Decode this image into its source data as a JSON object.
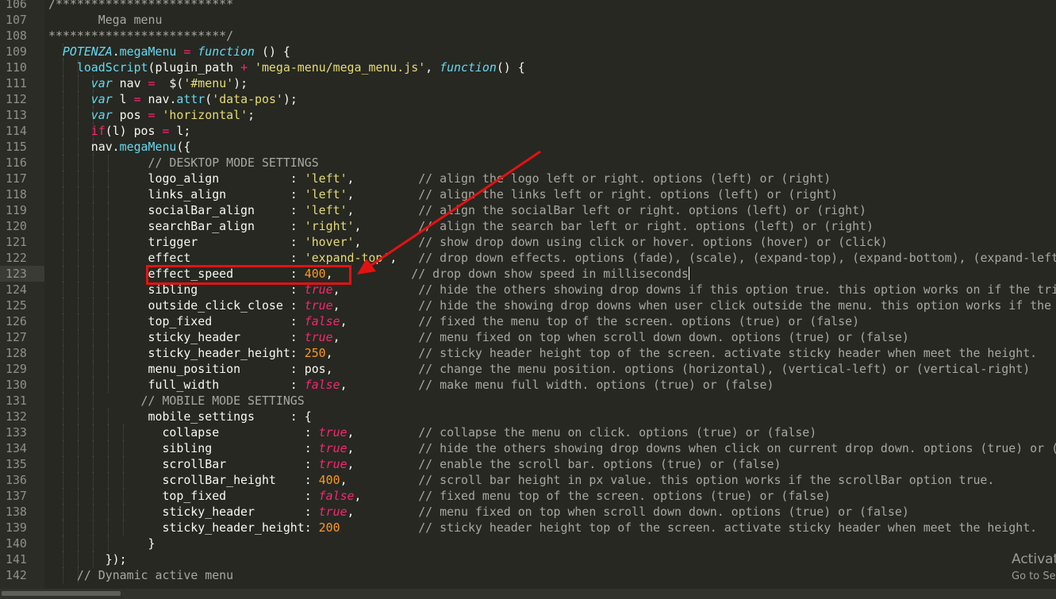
{
  "editor": {
    "current_line": 123,
    "lines": [
      {
        "n": "106",
        "indent": 0,
        "tokens": [
          {
            "t": "/*************************",
            "c": "com"
          }
        ]
      },
      {
        "n": "107",
        "indent": 0,
        "tokens": [
          {
            "t": "       Mega menu",
            "c": "com"
          }
        ]
      },
      {
        "n": "108",
        "indent": 0,
        "tokens": [
          {
            "t": "*************************/",
            "c": "com"
          }
        ]
      },
      {
        "n": "109",
        "indent": 1,
        "tokens": [
          {
            "t": "  POTENZA",
            "c": "gl"
          },
          {
            "t": ".",
            "c": "id"
          },
          {
            "t": "megaMenu",
            "c": "fn"
          },
          {
            "t": " = ",
            "c": "op"
          },
          {
            "t": "function",
            "c": "kw"
          },
          {
            "t": " () {",
            "c": "id"
          }
        ]
      },
      {
        "n": "110",
        "indent": 2,
        "tokens": [
          {
            "t": "    loadScript",
            "c": "fn"
          },
          {
            "t": "(plugin_path ",
            "c": "id"
          },
          {
            "t": "+",
            "c": "op"
          },
          {
            "t": " ",
            "c": "id"
          },
          {
            "t": "'mega-menu/mega_menu.js'",
            "c": "str"
          },
          {
            "t": ", ",
            "c": "id"
          },
          {
            "t": "function",
            "c": "kw"
          },
          {
            "t": "() {",
            "c": "id"
          }
        ]
      },
      {
        "n": "111",
        "indent": 3,
        "tokens": [
          {
            "t": "      ",
            "c": "id"
          },
          {
            "t": "var",
            "c": "kw"
          },
          {
            "t": " nav ",
            "c": "id"
          },
          {
            "t": "=",
            "c": "op"
          },
          {
            "t": "  $(",
            "c": "id"
          },
          {
            "t": "'#menu'",
            "c": "str"
          },
          {
            "t": ");",
            "c": "id"
          }
        ]
      },
      {
        "n": "112",
        "indent": 3,
        "tokens": [
          {
            "t": "      ",
            "c": "id"
          },
          {
            "t": "var",
            "c": "kw"
          },
          {
            "t": " l ",
            "c": "id"
          },
          {
            "t": "=",
            "c": "op"
          },
          {
            "t": " nav.",
            "c": "id"
          },
          {
            "t": "attr",
            "c": "fn"
          },
          {
            "t": "(",
            "c": "id"
          },
          {
            "t": "'data-pos'",
            "c": "str"
          },
          {
            "t": ");",
            "c": "id"
          }
        ]
      },
      {
        "n": "113",
        "indent": 3,
        "tokens": [
          {
            "t": "      ",
            "c": "id"
          },
          {
            "t": "var",
            "c": "kw"
          },
          {
            "t": " pos ",
            "c": "id"
          },
          {
            "t": "=",
            "c": "op"
          },
          {
            "t": " ",
            "c": "id"
          },
          {
            "t": "'horizontal'",
            "c": "str"
          },
          {
            "t": ";",
            "c": "id"
          }
        ]
      },
      {
        "n": "114",
        "indent": 3,
        "tokens": [
          {
            "t": "      ",
            "c": "id"
          },
          {
            "t": "if",
            "c": "op"
          },
          {
            "t": "(l) pos ",
            "c": "id"
          },
          {
            "t": "=",
            "c": "op"
          },
          {
            "t": " l;",
            "c": "id"
          }
        ]
      },
      {
        "n": "115",
        "indent": 3,
        "tokens": [
          {
            "t": "      nav.",
            "c": "id"
          },
          {
            "t": "megaMenu",
            "c": "fn"
          },
          {
            "t": "({",
            "c": "id"
          }
        ]
      },
      {
        "n": "116",
        "indent": 4,
        "tokens": [
          {
            "t": "              // DESKTOP MODE SETTINGS",
            "c": "com"
          }
        ]
      },
      {
        "n": "117",
        "indent": 4,
        "tokens": [
          {
            "t": "              logo_align          : ",
            "c": "id"
          },
          {
            "t": "'left'",
            "c": "str"
          },
          {
            "t": ",         ",
            "c": "id"
          },
          {
            "t": "// align the logo left or right. options (left) or (right)",
            "c": "com"
          }
        ]
      },
      {
        "n": "118",
        "indent": 4,
        "tokens": [
          {
            "t": "              links_align         : ",
            "c": "id"
          },
          {
            "t": "'left'",
            "c": "str"
          },
          {
            "t": ",         ",
            "c": "id"
          },
          {
            "t": "// align the links left or right. options (left) or (right)",
            "c": "com"
          }
        ]
      },
      {
        "n": "119",
        "indent": 4,
        "tokens": [
          {
            "t": "              socialBar_align     : ",
            "c": "id"
          },
          {
            "t": "'left'",
            "c": "str"
          },
          {
            "t": ",         ",
            "c": "id"
          },
          {
            "t": "// align the socialBar left or right. options (left) or (right)",
            "c": "com"
          }
        ]
      },
      {
        "n": "120",
        "indent": 4,
        "tokens": [
          {
            "t": "              searchBar_align     : ",
            "c": "id"
          },
          {
            "t": "'right'",
            "c": "str"
          },
          {
            "t": ",        ",
            "c": "id"
          },
          {
            "t": "// align the search bar left or right. options (left) or (right)",
            "c": "com"
          }
        ]
      },
      {
        "n": "121",
        "indent": 4,
        "tokens": [
          {
            "t": "              trigger             : ",
            "c": "id"
          },
          {
            "t": "'hover'",
            "c": "str"
          },
          {
            "t": ",        ",
            "c": "id"
          },
          {
            "t": "// show drop down using click or hover. options (hover) or (click)",
            "c": "com"
          }
        ]
      },
      {
        "n": "122",
        "indent": 4,
        "tokens": [
          {
            "t": "              effect              : ",
            "c": "id"
          },
          {
            "t": "'expand-top'",
            "c": "str"
          },
          {
            "t": ",   ",
            "c": "id"
          },
          {
            "t": "// drop down effects. options (fade), (scale), (expand-top), (expand-bottom), (expand-left), (expand-right)",
            "c": "com"
          }
        ]
      },
      {
        "n": "123",
        "indent": 4,
        "caret": true,
        "tokens": [
          {
            "t": "              effect_speed        : ",
            "c": "id"
          },
          {
            "t": "400",
            "c": "num2"
          },
          {
            "t": ",           ",
            "c": "id"
          },
          {
            "t": "// drop down show speed in milliseconds",
            "c": "com"
          }
        ]
      },
      {
        "n": "124",
        "indent": 4,
        "tokens": [
          {
            "t": "              sibling             : ",
            "c": "id"
          },
          {
            "t": "true",
            "c": "bool2"
          },
          {
            "t": ",           ",
            "c": "id"
          },
          {
            "t": "// hide the others showing drop downs if this option true. this option works on if the trigger option is click.",
            "c": "com"
          }
        ]
      },
      {
        "n": "125",
        "indent": 4,
        "tokens": [
          {
            "t": "              outside_click_close : ",
            "c": "id"
          },
          {
            "t": "true",
            "c": "bool2"
          },
          {
            "t": ",           ",
            "c": "id"
          },
          {
            "t": "// hide the showing drop downs when user click outside the menu. this option works if the trigger option is click.",
            "c": "com"
          }
        ]
      },
      {
        "n": "126",
        "indent": 4,
        "tokens": [
          {
            "t": "              top_fixed           : ",
            "c": "id"
          },
          {
            "t": "false",
            "c": "bool2"
          },
          {
            "t": ",          ",
            "c": "id"
          },
          {
            "t": "// fixed the menu top of the screen. options (true) or (false)",
            "c": "com"
          }
        ]
      },
      {
        "n": "127",
        "indent": 4,
        "tokens": [
          {
            "t": "              sticky_header       : ",
            "c": "id"
          },
          {
            "t": "true",
            "c": "bool2"
          },
          {
            "t": ",           ",
            "c": "id"
          },
          {
            "t": "// menu fixed on top when scroll down down. options (true) or (false)",
            "c": "com"
          }
        ]
      },
      {
        "n": "128",
        "indent": 4,
        "tokens": [
          {
            "t": "              sticky_header_height: ",
            "c": "id"
          },
          {
            "t": "250",
            "c": "num2"
          },
          {
            "t": ",            ",
            "c": "id"
          },
          {
            "t": "// sticky header height top of the screen. activate sticky header when meet the height.",
            "c": "com"
          }
        ]
      },
      {
        "n": "129",
        "indent": 4,
        "tokens": [
          {
            "t": "              menu_position       : pos,            ",
            "c": "id"
          },
          {
            "t": "// change the menu position. options (horizontal), (vertical-left) or (vertical-right)",
            "c": "com"
          }
        ]
      },
      {
        "n": "130",
        "indent": 4,
        "tokens": [
          {
            "t": "              full_width          : ",
            "c": "id"
          },
          {
            "t": "false",
            "c": "bool2"
          },
          {
            "t": ",          ",
            "c": "id"
          },
          {
            "t": "// make menu full width. options (true) or (false)",
            "c": "com"
          }
        ]
      },
      {
        "n": "131",
        "indent": 3,
        "tokens": [
          {
            "t": "             // MOBILE MODE SETTINGS",
            "c": "com"
          }
        ]
      },
      {
        "n": "132",
        "indent": 4,
        "tokens": [
          {
            "t": "              mobile_settings     : {",
            "c": "id"
          }
        ]
      },
      {
        "n": "133",
        "indent": 5,
        "tokens": [
          {
            "t": "                collapse            : ",
            "c": "id"
          },
          {
            "t": "true",
            "c": "bool2"
          },
          {
            "t": ",         ",
            "c": "id"
          },
          {
            "t": "// collapse the menu on click. options (true) or (false)",
            "c": "com"
          }
        ]
      },
      {
        "n": "134",
        "indent": 5,
        "tokens": [
          {
            "t": "                sibling             : ",
            "c": "id"
          },
          {
            "t": "true",
            "c": "bool2"
          },
          {
            "t": ",         ",
            "c": "id"
          },
          {
            "t": "// hide the others showing drop downs when click on current drop down. options (true) or (false)",
            "c": "com"
          }
        ]
      },
      {
        "n": "135",
        "indent": 5,
        "tokens": [
          {
            "t": "                scrollBar           : ",
            "c": "id"
          },
          {
            "t": "true",
            "c": "bool2"
          },
          {
            "t": ",         ",
            "c": "id"
          },
          {
            "t": "// enable the scroll bar. options (true) or (false)",
            "c": "com"
          }
        ]
      },
      {
        "n": "136",
        "indent": 5,
        "tokens": [
          {
            "t": "                scrollBar_height    : ",
            "c": "id"
          },
          {
            "t": "400",
            "c": "num2"
          },
          {
            "t": ",          ",
            "c": "id"
          },
          {
            "t": "// scroll bar height in px value. this option works if the scrollBar option true.",
            "c": "com"
          }
        ]
      },
      {
        "n": "137",
        "indent": 5,
        "tokens": [
          {
            "t": "                top_fixed           : ",
            "c": "id"
          },
          {
            "t": "false",
            "c": "bool2"
          },
          {
            "t": ",        ",
            "c": "id"
          },
          {
            "t": "// fixed menu top of the screen. options (true) or (false)",
            "c": "com"
          }
        ]
      },
      {
        "n": "138",
        "indent": 5,
        "tokens": [
          {
            "t": "                sticky_header       : ",
            "c": "id"
          },
          {
            "t": "true",
            "c": "bool2"
          },
          {
            "t": ",         ",
            "c": "id"
          },
          {
            "t": "// menu fixed on top when scroll down down. options (true) or (false)",
            "c": "com"
          }
        ]
      },
      {
        "n": "139",
        "indent": 5,
        "tokens": [
          {
            "t": "                sticky_header_height: ",
            "c": "id"
          },
          {
            "t": "200",
            "c": "num2"
          },
          {
            "t": "           ",
            "c": "id"
          },
          {
            "t": "// sticky header height top of the screen. activate sticky header when meet the height.",
            "c": "com"
          }
        ]
      },
      {
        "n": "140",
        "indent": 4,
        "tokens": [
          {
            "t": "              }",
            "c": "id"
          }
        ]
      },
      {
        "n": "141",
        "indent": 3,
        "tokens": [
          {
            "t": "        });",
            "c": "id"
          }
        ]
      },
      {
        "n": "142",
        "indent": 2,
        "tokens": [
          {
            "t": "    ",
            "c": "id"
          },
          {
            "t": "// Dynamic active menu",
            "c": "com"
          }
        ]
      }
    ]
  },
  "watermark": {
    "title": "Activat",
    "subtitle": "Go to Se"
  },
  "colors": {
    "annotation": "#e31212",
    "background": "#272822"
  }
}
